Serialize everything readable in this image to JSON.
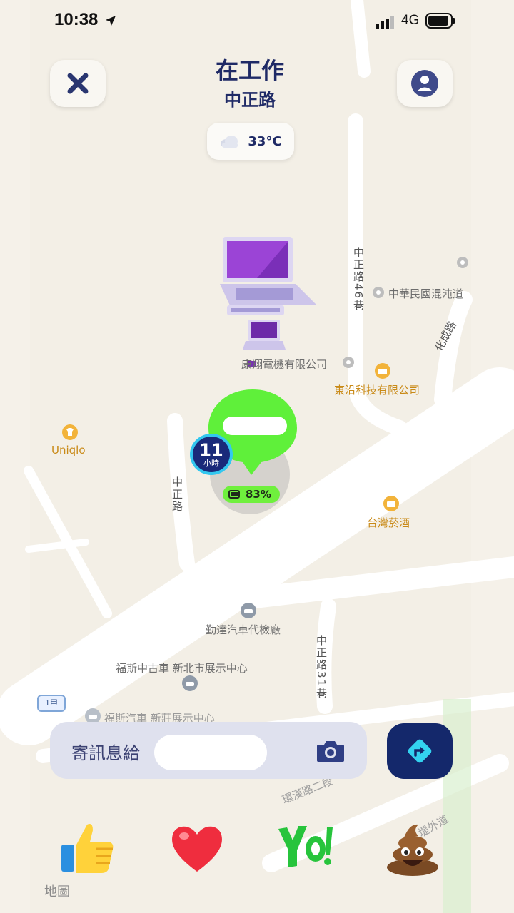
{
  "status_bar": {
    "time": "10:38",
    "network": "4G"
  },
  "header": {
    "title": "在工作",
    "subtitle": "中正路"
  },
  "weather": {
    "temperature": "33°C",
    "icon": "cloud-icon"
  },
  "map": {
    "pois": [
      {
        "id": "fanshuo",
        "label": "康翔電機有限公司"
      },
      {
        "id": "dongye",
        "label": "東沿科技有限公司"
      },
      {
        "id": "mixdao",
        "label": "中華民國混沌道"
      },
      {
        "id": "uniqlo",
        "label": "Uniqlo"
      },
      {
        "id": "tobacco",
        "label": "台灣菸酒"
      },
      {
        "id": "car_inspect",
        "label": "勤達汽車代檢廠"
      },
      {
        "id": "ford_used",
        "label": "福斯中古車 新北市展示中心"
      },
      {
        "id": "ford_xz",
        "label": "福斯汽車 新莊展示中心"
      }
    ],
    "roads": {
      "lane46": "中正路46巷",
      "huacheng": "化成路",
      "zhongzheng": "中正路",
      "lane31": "中正路31巷",
      "huanhan": "環漢路二段",
      "river_outer": "堤外道",
      "route_badge": "1甲"
    },
    "legal": "地圖"
  },
  "user_marker": {
    "hours": "11",
    "hours_unit": "小時",
    "battery": "83%"
  },
  "message_bar": {
    "placeholder": "寄訊息給",
    "camera_icon": "camera-icon",
    "send_icon": "directions-icon"
  },
  "reactions": [
    {
      "name": "thumbs-up-icon"
    },
    {
      "name": "heart-icon"
    },
    {
      "name": "yo-icon"
    },
    {
      "name": "poop-icon"
    }
  ],
  "colors": {
    "primary": "#1f2a66",
    "battery": "#6ff03d",
    "marker": "#5ff03a",
    "send": "#14286b"
  }
}
